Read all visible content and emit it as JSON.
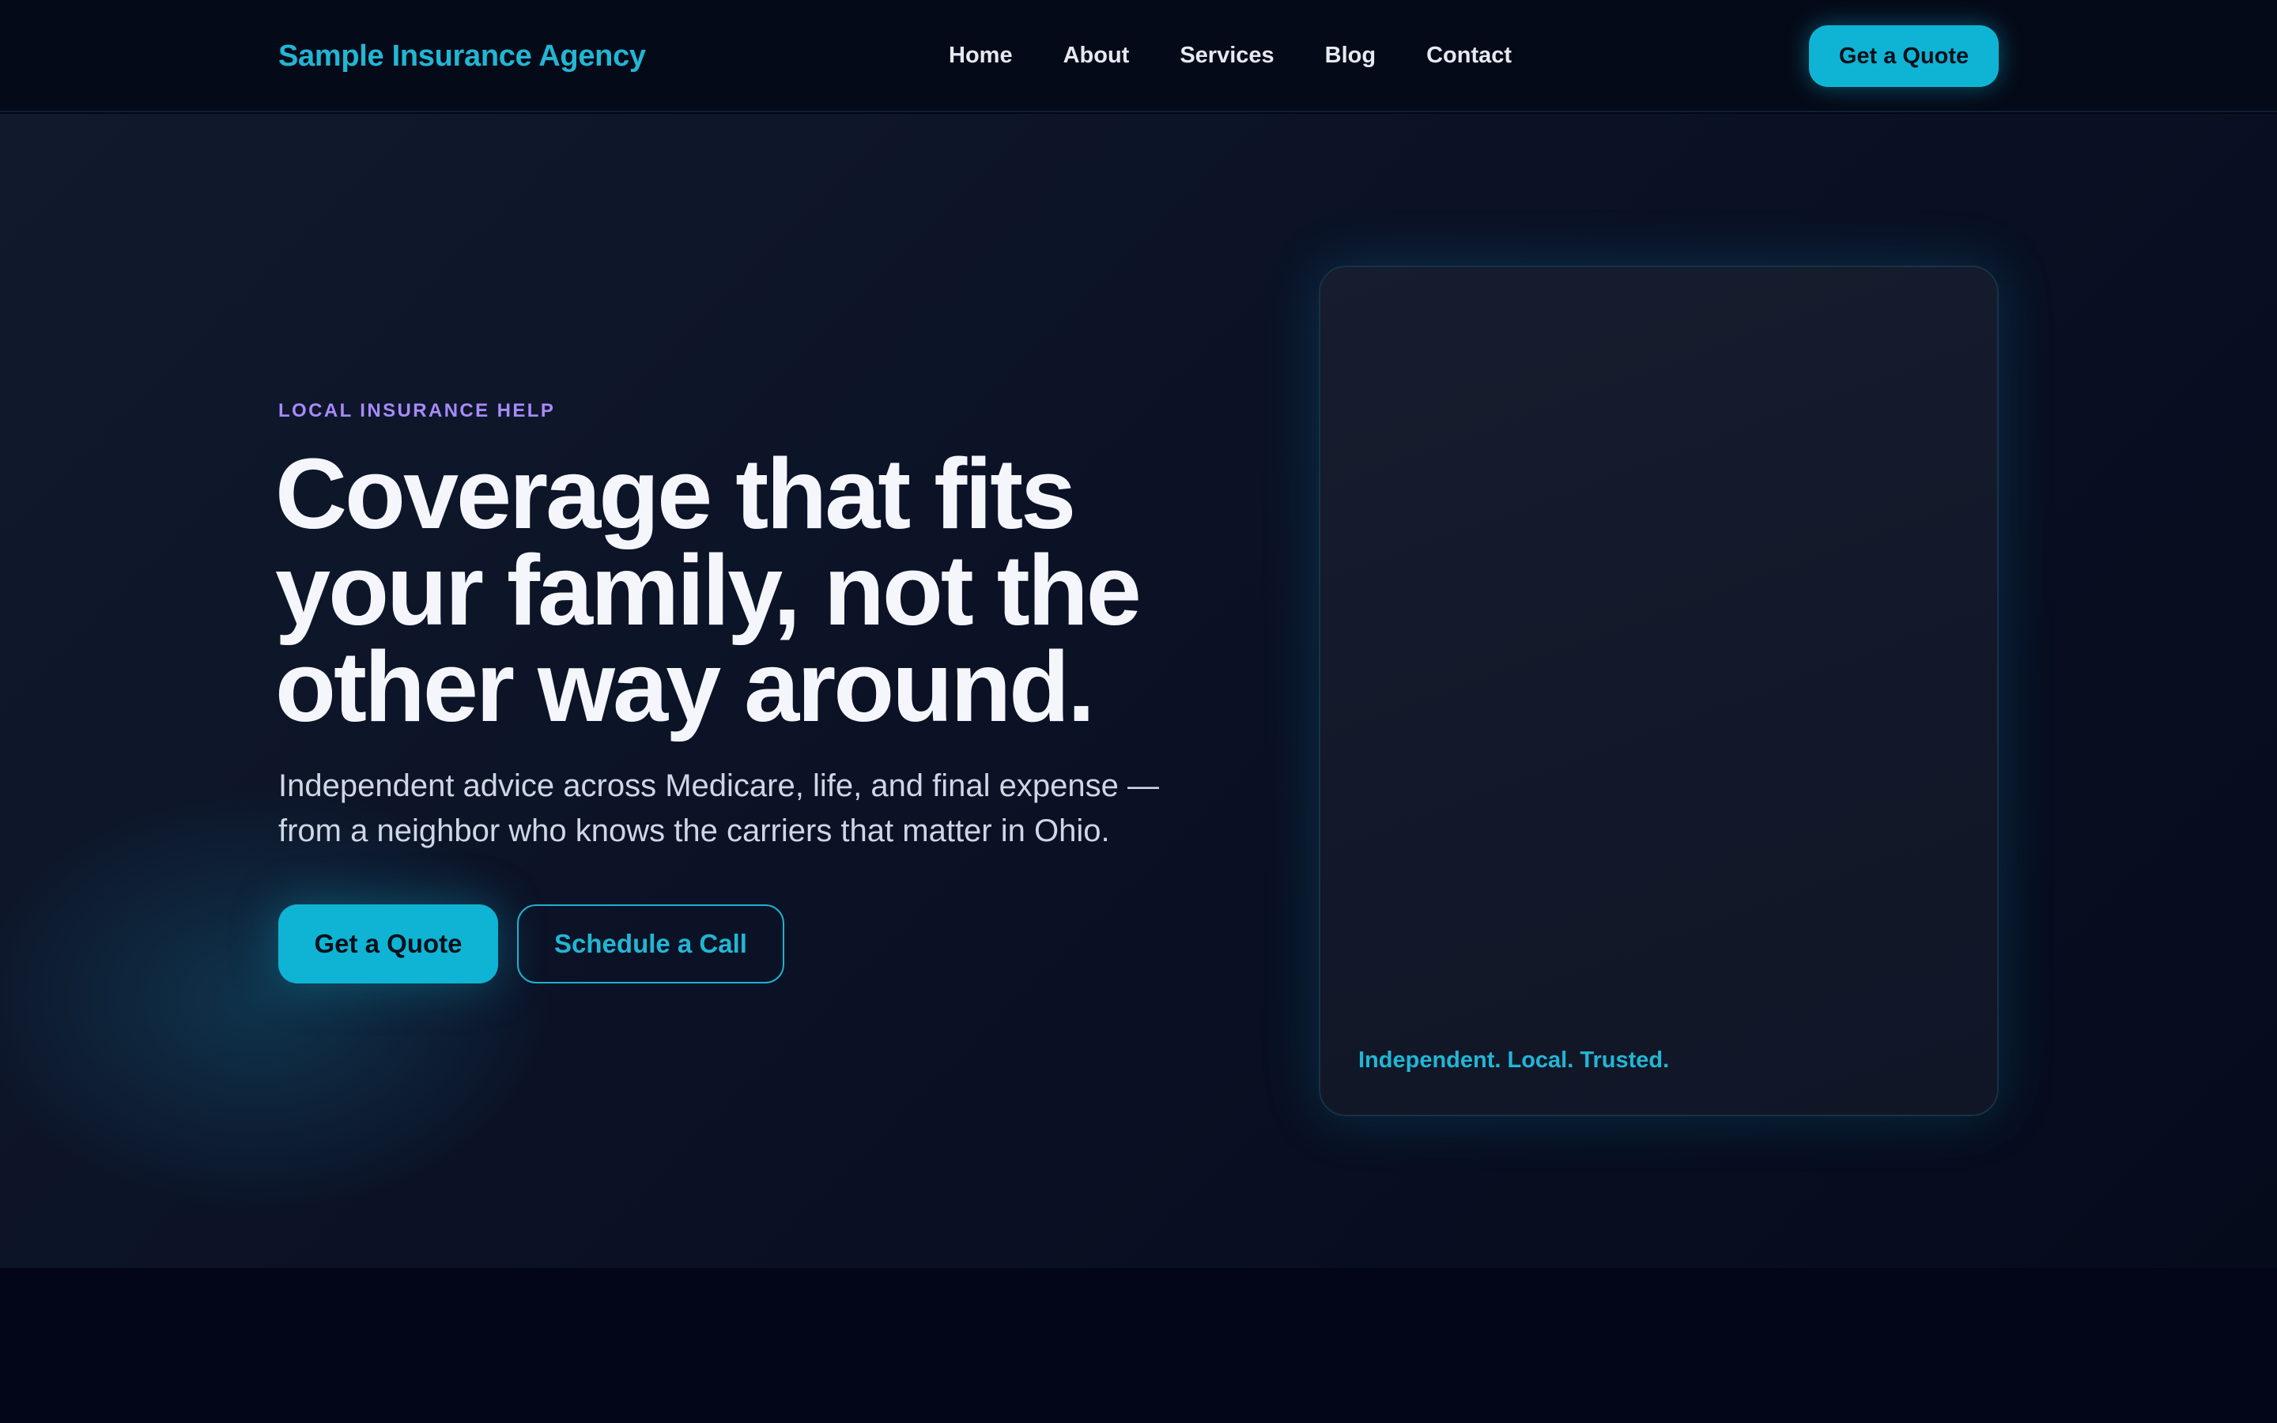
{
  "header": {
    "brand": "Sample Insurance Agency",
    "nav": [
      "Home",
      "About",
      "Services",
      "Blog",
      "Contact"
    ],
    "cta_label": "Get a Quote"
  },
  "hero": {
    "eyebrow": "LOCAL INSURANCE HELP",
    "headline_lines": [
      "Coverage that fits",
      "your family, not the",
      "other way around."
    ],
    "subhead_lines": [
      "Independent advice across Medicare, life, and final expense —",
      "from a neighbor who knows the carriers that matter in Ohio."
    ],
    "primary_button": "Get a Quote",
    "secondary_button": "Schedule a Call",
    "card_caption": "Independent. Local. Trusted."
  },
  "colors": {
    "accent": "#0fb4d4",
    "eyebrow": "#a78bfa",
    "background": "#030716"
  }
}
